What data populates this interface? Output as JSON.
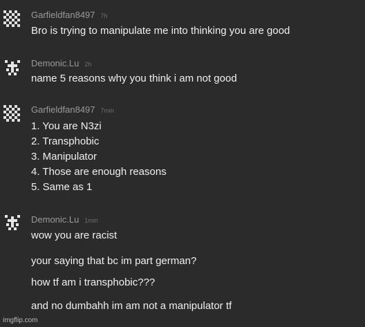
{
  "comments": [
    {
      "username": "Garfieldfan8497",
      "time": "7h",
      "avatar": "checker-pattern-avatar",
      "lines": [
        "Bro is trying to manipulate me into thinking you are good"
      ]
    },
    {
      "username": "Demonic.Lu",
      "time": "2h",
      "avatar": "pixel-cross-avatar",
      "lines": [
        "name 5 reasons why you think i am not good"
      ]
    },
    {
      "username": "Garfieldfan8497",
      "time": "7min",
      "avatar": "checker-pattern-avatar",
      "lines": [
        "1. You are N3zi",
        "2. Transphobic",
        "3. Manipulator",
        "4. Those are enough reasons",
        "5. Same as 1"
      ]
    },
    {
      "username": "Demonic.Lu",
      "time": "1min",
      "avatar": "pixel-cross-avatar",
      "lines": [
        "wow you are racist",
        "your saying that bc im part german?",
        "how tf am i transphobic???",
        "and no dumbahh im am not a manipulator tf"
      ]
    }
  ],
  "watermark": "imgflip.com",
  "colors": {
    "background": "#2b2b2b",
    "username": "#9a9a9a",
    "timestamp": "#6e6e6e",
    "text": "#f0f0f0"
  }
}
